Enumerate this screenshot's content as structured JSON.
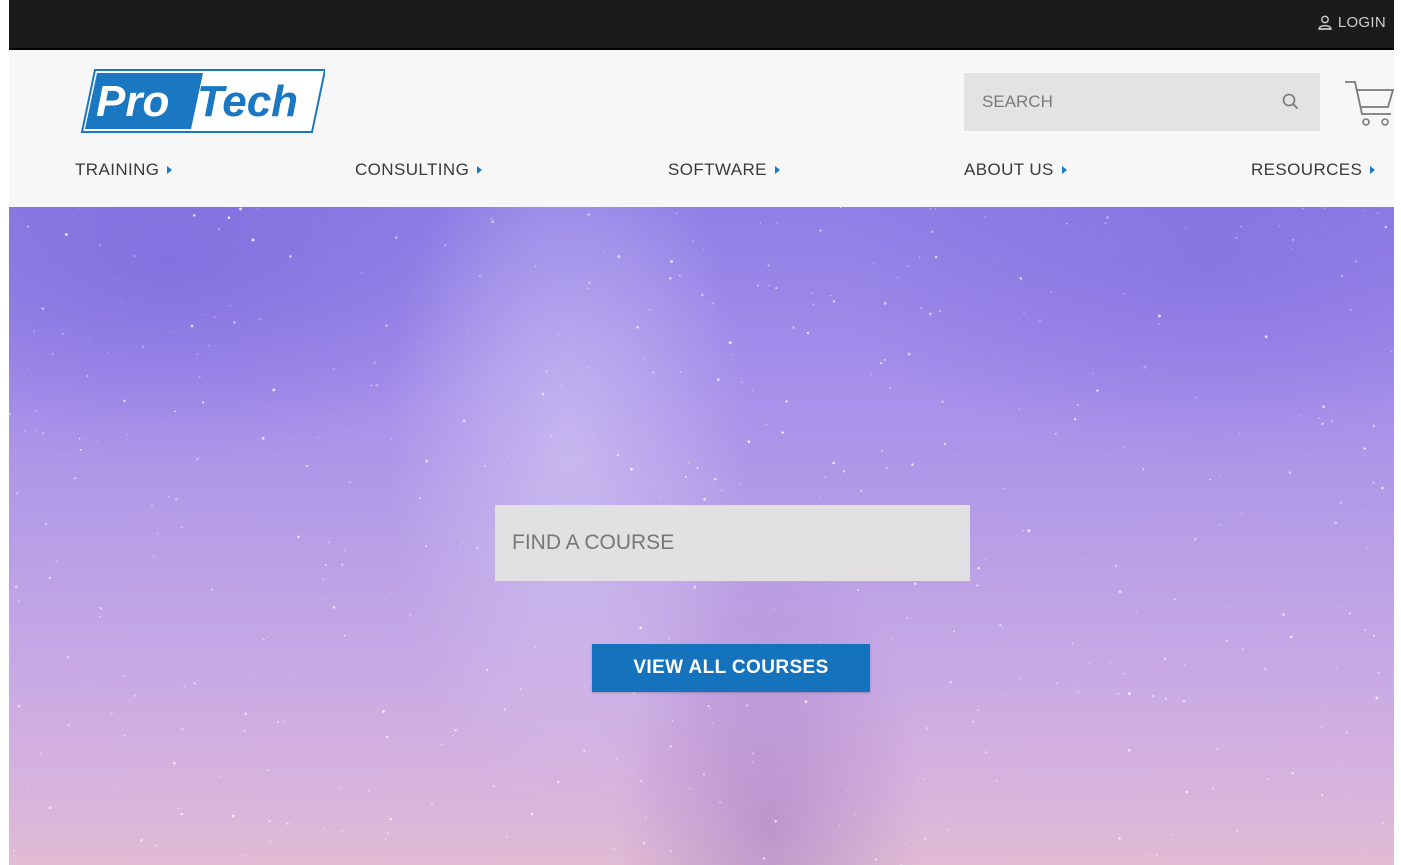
{
  "topbar": {
    "login_label": "LOGIN",
    "login_icon": "user-icon"
  },
  "header": {
    "logo": {
      "part1": "Pro",
      "part2": "Tech",
      "brand_blue": "#1a78c2"
    },
    "search": {
      "placeholder": "SEARCH",
      "icon": "search-icon"
    },
    "cart_icon": "cart-icon"
  },
  "nav": {
    "items": [
      {
        "label": "TRAINING"
      },
      {
        "label": "CONSULTING"
      },
      {
        "label": "SOFTWARE"
      },
      {
        "label": "ABOUT US"
      },
      {
        "label": "RESOURCES"
      }
    ],
    "caret_icon": "caret-right-icon",
    "caret_color": "#1a78c2"
  },
  "hero": {
    "course_search_placeholder": "FIND A COURSE",
    "view_all_label": "VIEW ALL COURSES",
    "button_color": "#1573bd"
  }
}
